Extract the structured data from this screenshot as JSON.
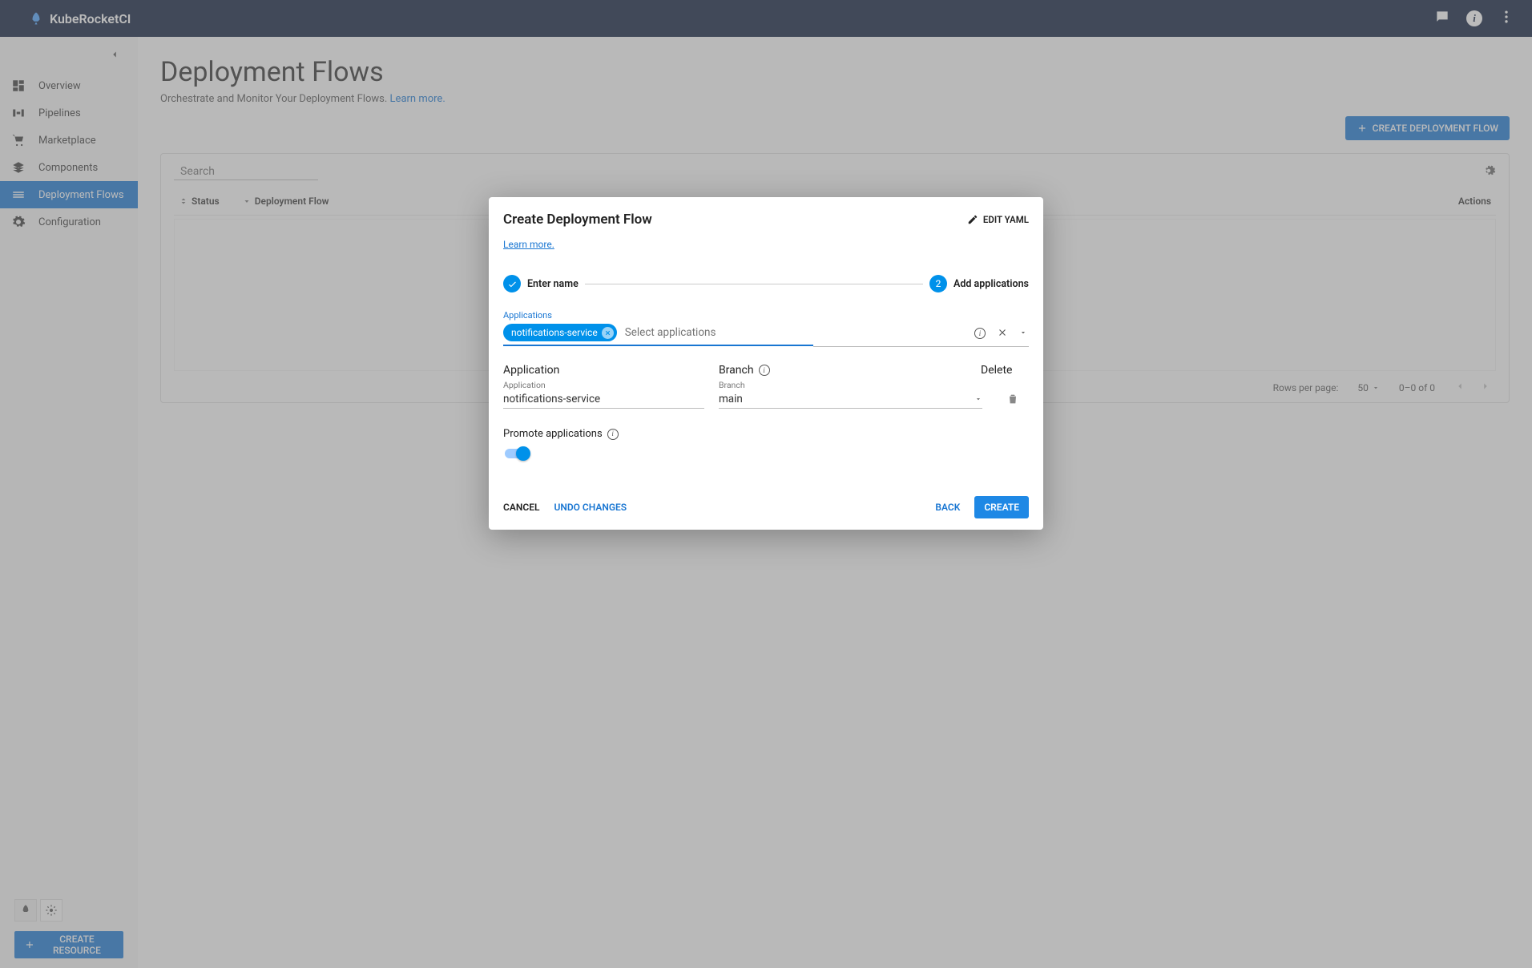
{
  "brand": "KubeRocketCI",
  "sidebar": {
    "items": [
      {
        "label": "Overview",
        "icon": "dashboard"
      },
      {
        "label": "Pipelines",
        "icon": "pipeline"
      },
      {
        "label": "Marketplace",
        "icon": "cart"
      },
      {
        "label": "Components",
        "icon": "layers"
      },
      {
        "label": "Deployment Flows",
        "icon": "flows",
        "active": true
      },
      {
        "label": "Configuration",
        "icon": "gear"
      }
    ],
    "createResource": "CREATE RESOURCE"
  },
  "page": {
    "title": "Deployment Flows",
    "subtitle": "Orchestrate and Monitor Your Deployment Flows.",
    "learnMore": "Learn more.",
    "createButton": "CREATE DEPLOYMENT FLOW",
    "searchPlaceholder": "Search",
    "columns": {
      "status": "Status",
      "name": "Deployment Flow",
      "actions": "Actions"
    },
    "pager": {
      "rowsLabel": "Rows per page:",
      "rows": "50",
      "range": "0–0 of 0"
    }
  },
  "dialog": {
    "title": "Create Deployment Flow",
    "editYaml": "EDIT YAML",
    "learnMore": "Learn more.",
    "step1": "Enter name",
    "step2": "Add applications",
    "applicationsLabel": "Applications",
    "chip": "notifications-service",
    "selectPlaceholder": "Select applications",
    "colApplication": "Application",
    "colBranch": "Branch",
    "colDelete": "Delete",
    "appFieldLabel": "Application",
    "appFieldValue": "notifications-service",
    "branchFieldLabel": "Branch",
    "branchFieldValue": "main",
    "promote": "Promote applications",
    "cancel": "CANCEL",
    "undo": "UNDO CHANGES",
    "back": "BACK",
    "create": "CREATE"
  }
}
